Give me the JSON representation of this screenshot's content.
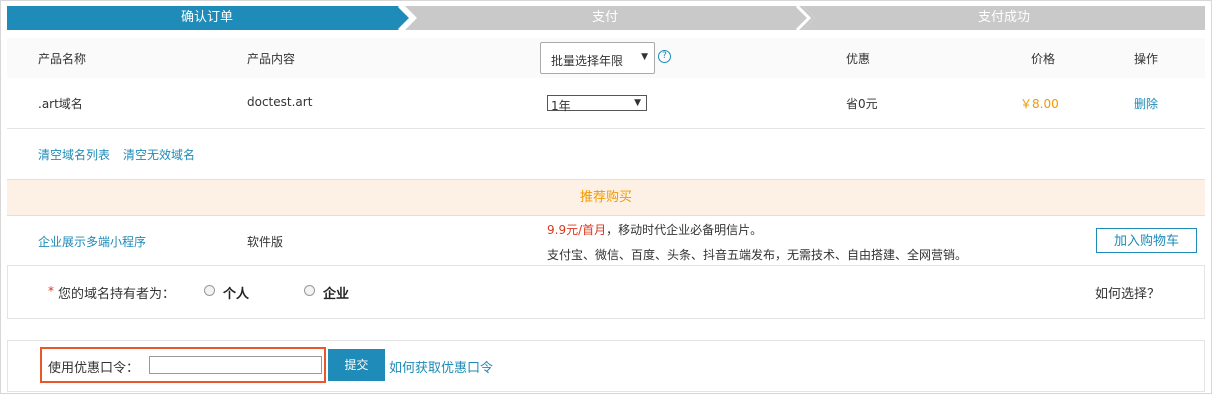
{
  "steps": [
    {
      "label": "确认订单",
      "active": true
    },
    {
      "label": "支付",
      "active": false
    },
    {
      "label": "支付成功",
      "active": false
    }
  ],
  "colors": {
    "accent": "#1e8bb8",
    "inactive_step": "#c9c9c9",
    "price": "#f39800",
    "recommend_bg": "#fcf1e4",
    "highlight_border": "#e8572a"
  },
  "table": {
    "headers": {
      "name": "产品名称",
      "content": "产品内容",
      "discount": "优惠",
      "price": "价格",
      "action": "操作"
    },
    "year_select": {
      "selected": "批量选择年限"
    },
    "help_icon": "question-circle-icon",
    "rows": [
      {
        "name": ".art域名",
        "content": "doctest.art",
        "years": "1年",
        "discount": "省0元",
        "price": "￥8.00",
        "action": "删除"
      }
    ]
  },
  "list_actions": {
    "clear_list": "清空域名列表",
    "clear_invalid": "清空无效域名"
  },
  "recommend": {
    "title": "推荐购买",
    "product": "企业展示多端小程序",
    "edition": "软件版",
    "price_text": "9.9元/首月",
    "desc1": "，移动时代企业必备明信片。",
    "desc2": "支付宝、微信、百度、头条、抖音五端发布，无需技术、自由搭建、全网营销。",
    "add_to_cart": "加入购物车"
  },
  "holder": {
    "required_mark": "*",
    "label": "您的域名持有者为：",
    "options": [
      "个人",
      "企业"
    ],
    "help_link": "如何选择？"
  },
  "promo": {
    "label": "使用优惠口令：",
    "input_value": "",
    "submit": "提交",
    "help_link": "如何获取优惠口令"
  }
}
